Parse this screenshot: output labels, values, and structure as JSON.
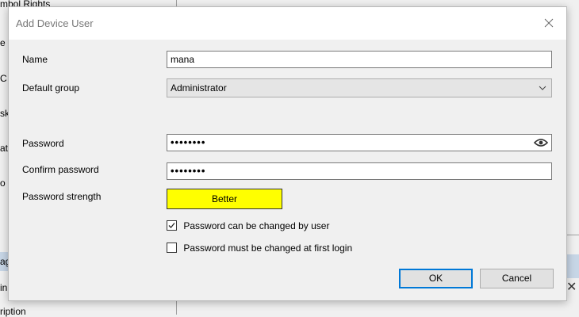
{
  "background": {
    "fragments": [
      "mbol Rights",
      "e",
      "C",
      "sk",
      "at",
      "o",
      "ag",
      "in",
      "ription"
    ]
  },
  "dialog": {
    "title": "Add Device User",
    "close_icon": "close-icon",
    "fields": {
      "name_label": "Name",
      "name_value": "mana",
      "group_label": "Default group",
      "group_value": "Administrator",
      "password_label": "Password",
      "password_value": "••••••••",
      "confirm_label": "Confirm password",
      "confirm_value": "••••••••",
      "strength_label": "Password strength",
      "strength_value": "Better",
      "strength_color": "#ffff00"
    },
    "checkboxes": [
      {
        "label": "Password can be changed by user",
        "checked": true
      },
      {
        "label": "Password must be changed at first login",
        "checked": false
      }
    ],
    "buttons": {
      "ok": "OK",
      "cancel": "Cancel"
    }
  }
}
